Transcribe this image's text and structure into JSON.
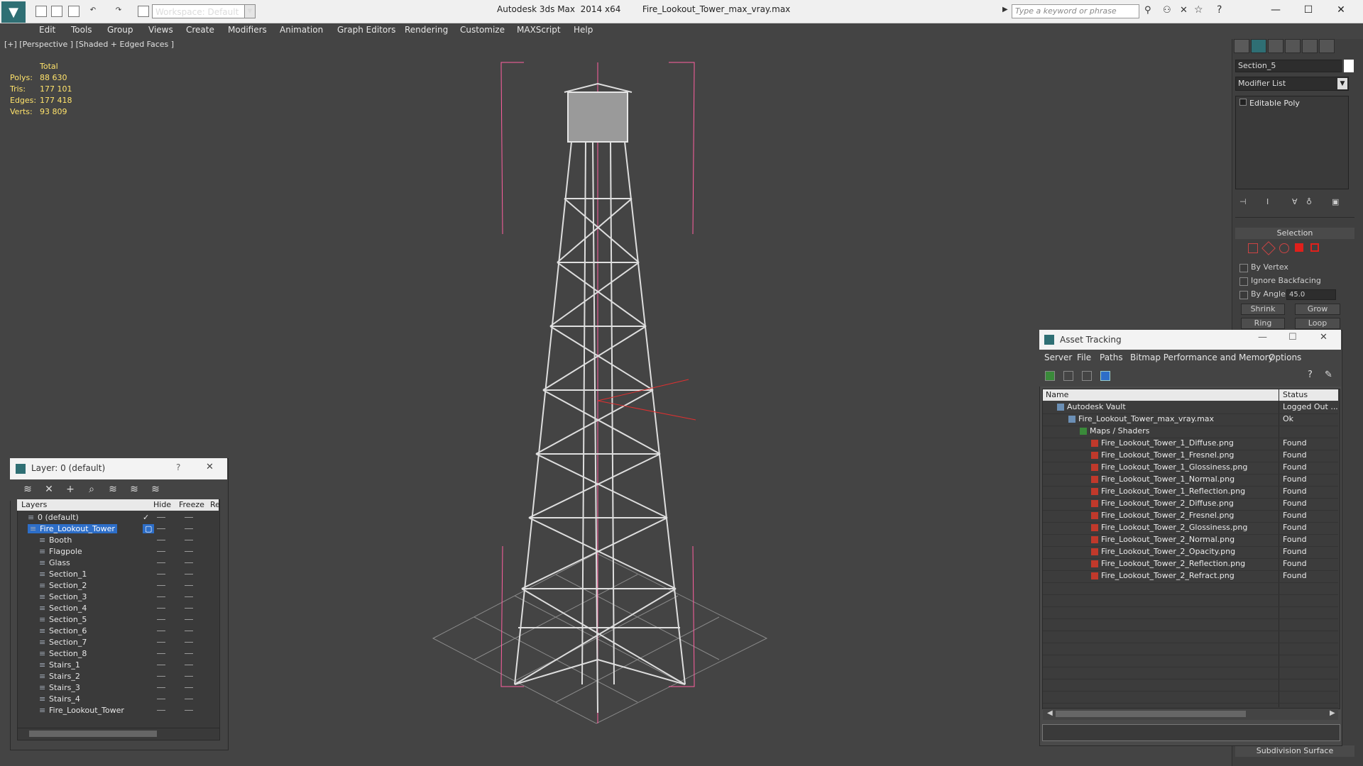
{
  "titlebar": {
    "workspace": "Workspace: Default",
    "app_title": "Autodesk 3ds Max  2014 x64        Fire_Lookout_Tower_max_vray.max",
    "search_placeholder": "Type a keyword or phrase"
  },
  "menu": [
    "Edit",
    "Tools",
    "Group",
    "Views",
    "Create",
    "Modifiers",
    "Animation",
    "Graph Editors",
    "Rendering",
    "Customize",
    "MAXScript",
    "Help"
  ],
  "viewport": {
    "label": "[+] [Perspective ] [Shaded + Edged Faces ]",
    "stats": {
      "total_label": "Total",
      "rows": [
        {
          "k": "Polys:",
          "v": "88 630"
        },
        {
          "k": "Tris:",
          "v": "177 101"
        },
        {
          "k": "Edges:",
          "v": "177 418"
        },
        {
          "k": "Verts:",
          "v": "93 809"
        }
      ]
    }
  },
  "command_panel": {
    "object_name": "Section_5",
    "modifier_list": "Modifier List",
    "stack_item": "Editable Poly",
    "selection_header": "Selection",
    "by_vertex": "By Vertex",
    "ignore_backfacing": "Ignore Backfacing",
    "by_angle": "By Angle:",
    "angle_value": "45.0",
    "shrink": "Shrink",
    "grow": "Grow",
    "ring": "Ring",
    "loop": "Loop",
    "subdivision_header": "Subdivision Surface"
  },
  "layer_panel": {
    "title": "Layer: 0 (default)",
    "help": "?",
    "columns": {
      "layers": "Layers",
      "hide": "Hide",
      "freeze": "Freeze",
      "render": "Re"
    },
    "rows": [
      {
        "name": "0 (default)",
        "indent": 1
      },
      {
        "name": "Fire_Lookout_Tower",
        "indent": 1,
        "selected": true
      },
      {
        "name": "Booth",
        "indent": 2
      },
      {
        "name": "Flagpole",
        "indent": 2
      },
      {
        "name": "Glass",
        "indent": 2
      },
      {
        "name": "Section_1",
        "indent": 2
      },
      {
        "name": "Section_2",
        "indent": 2
      },
      {
        "name": "Section_3",
        "indent": 2
      },
      {
        "name": "Section_4",
        "indent": 2
      },
      {
        "name": "Section_5",
        "indent": 2
      },
      {
        "name": "Section_6",
        "indent": 2
      },
      {
        "name": "Section_7",
        "indent": 2
      },
      {
        "name": "Section_8",
        "indent": 2
      },
      {
        "name": "Stairs_1",
        "indent": 2
      },
      {
        "name": "Stairs_2",
        "indent": 2
      },
      {
        "name": "Stairs_3",
        "indent": 2
      },
      {
        "name": "Stairs_4",
        "indent": 2
      },
      {
        "name": "Fire_Lookout_Tower",
        "indent": 2
      }
    ]
  },
  "asset_tracking": {
    "title": "Asset Tracking",
    "menu": [
      "Server",
      "File",
      "Paths",
      "Bitmap Performance and Memory",
      "Options"
    ],
    "columns": {
      "name": "Name",
      "status": "Status"
    },
    "rows": [
      {
        "name": "Autodesk Vault",
        "status": "Logged Out ...",
        "indent": 0,
        "kind": "vault"
      },
      {
        "name": "Fire_Lookout_Tower_max_vray.max",
        "status": "Ok",
        "indent": 1,
        "kind": "max"
      },
      {
        "name": "Maps / Shaders",
        "status": "",
        "indent": 2,
        "kind": "maps"
      },
      {
        "name": "Fire_Lookout_Tower_1_Diffuse.png",
        "status": "Found",
        "indent": 3,
        "kind": "png"
      },
      {
        "name": "Fire_Lookout_Tower_1_Fresnel.png",
        "status": "Found",
        "indent": 3,
        "kind": "png"
      },
      {
        "name": "Fire_Lookout_Tower_1_Glossiness.png",
        "status": "Found",
        "indent": 3,
        "kind": "png"
      },
      {
        "name": "Fire_Lookout_Tower_1_Normal.png",
        "status": "Found",
        "indent": 3,
        "kind": "png"
      },
      {
        "name": "Fire_Lookout_Tower_1_Reflection.png",
        "status": "Found",
        "indent": 3,
        "kind": "png"
      },
      {
        "name": "Fire_Lookout_Tower_2_Diffuse.png",
        "status": "Found",
        "indent": 3,
        "kind": "png"
      },
      {
        "name": "Fire_Lookout_Tower_2_Fresnel.png",
        "status": "Found",
        "indent": 3,
        "kind": "png"
      },
      {
        "name": "Fire_Lookout_Tower_2_Glossiness.png",
        "status": "Found",
        "indent": 3,
        "kind": "png"
      },
      {
        "name": "Fire_Lookout_Tower_2_Normal.png",
        "status": "Found",
        "indent": 3,
        "kind": "png"
      },
      {
        "name": "Fire_Lookout_Tower_2_Opacity.png",
        "status": "Found",
        "indent": 3,
        "kind": "png"
      },
      {
        "name": "Fire_Lookout_Tower_2_Reflection.png",
        "status": "Found",
        "indent": 3,
        "kind": "png"
      },
      {
        "name": "Fire_Lookout_Tower_2_Refract.png",
        "status": "Found",
        "indent": 3,
        "kind": "png"
      }
    ]
  },
  "colors": {
    "accent": "#2d6ec8",
    "stats": "#ffe36b",
    "selection_mode_active": "#e0201b",
    "png_icon": "#c0392b"
  }
}
